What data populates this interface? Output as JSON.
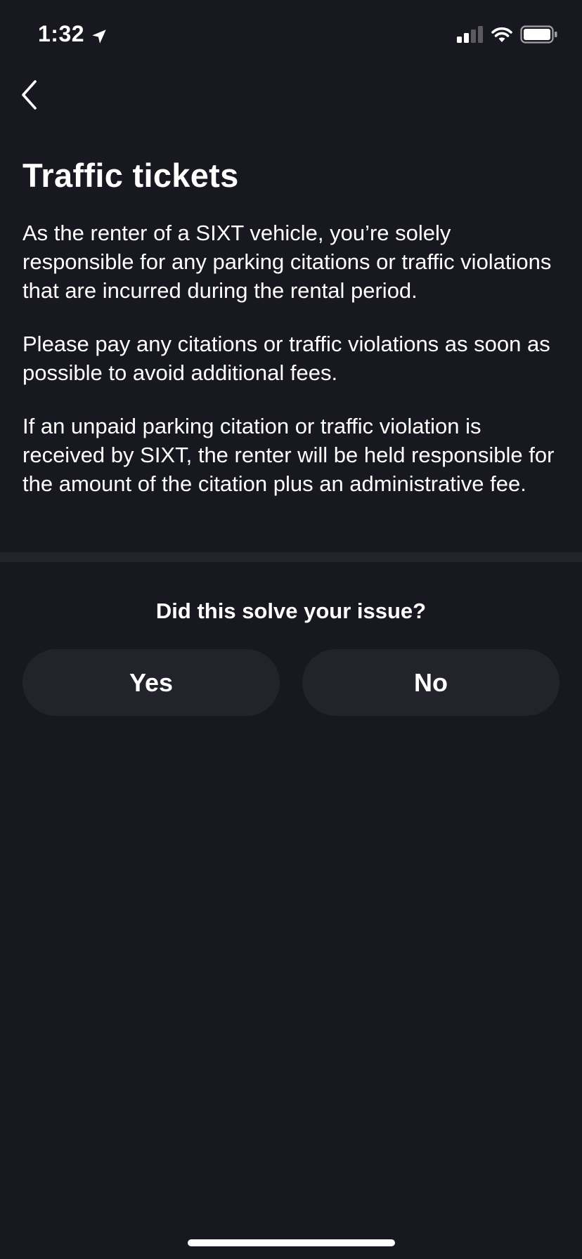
{
  "status_bar": {
    "time": "1:32",
    "location_icon": "location-arrow-icon",
    "signal_icon": "cellular-signal-icon",
    "wifi_icon": "wifi-icon",
    "battery_icon": "battery-icon"
  },
  "nav": {
    "back_icon": "chevron-left-icon"
  },
  "page": {
    "title": "Traffic tickets",
    "paragraphs": [
      "As the renter of a SIXT vehicle, you’re solely responsible for any parking citations or traffic violations that are incurred during the rental period.",
      "Please pay any citations or traffic violations as soon as possible to avoid additional fees.",
      "If an unpaid parking citation or traffic violation is received by SIXT, the renter will be held responsible for the amount of the citation plus an administrative fee."
    ]
  },
  "feedback": {
    "question": "Did this solve your issue?",
    "yes_label": "Yes",
    "no_label": "No"
  },
  "colors": {
    "background": "#181820",
    "button_background": "#22232b",
    "divider": "#23242c",
    "text": "#ffffff"
  }
}
